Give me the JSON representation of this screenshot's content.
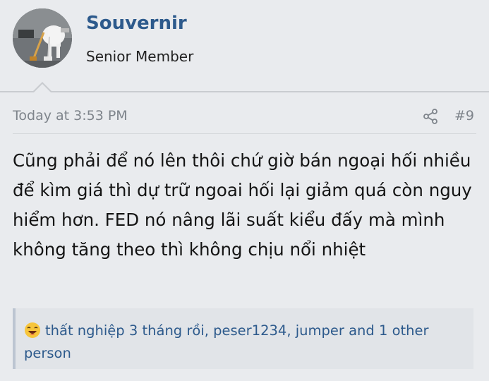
{
  "user": {
    "username": "Souvernir",
    "title": "Senior Member"
  },
  "post": {
    "timestamp": "Today at 3:53 PM",
    "number": "#9",
    "body": "Cũng phải để nó lên thôi chứ giờ bán ngoại hối nhiều để kìm giá thì dự trữ ngoai hối lại giảm quá còn nguy hiểm hơn. FED nó nâng lãi suất kiểu đấy mà mình không tăng theo thì không chịu nổi nhiệt"
  },
  "reactions": {
    "icon": "haha-emoji-icon",
    "text": "thất nghiệp 3 tháng rồi, peser1234, jumper and 1 other person"
  },
  "colors": {
    "username": "#2d5a8c",
    "reaction_link": "#2d5a8c",
    "meta": "#7e848b",
    "background": "#e9ebee"
  }
}
